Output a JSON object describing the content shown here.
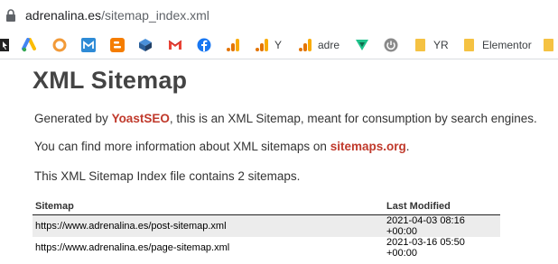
{
  "browser": {
    "url_host": "adrenalina.es",
    "url_path": "/sitemap_index.xml",
    "bookmarks": [
      {
        "icon": "cursor-icon",
        "label": ""
      },
      {
        "icon": "google-ads-icon",
        "label": ""
      },
      {
        "icon": "orange-ring-icon",
        "label": ""
      },
      {
        "icon": "mailchimp-icon",
        "label": ""
      },
      {
        "icon": "blogger-icon",
        "label": ""
      },
      {
        "icon": "cube-icon",
        "label": ""
      },
      {
        "icon": "gmail-icon",
        "label": ""
      },
      {
        "icon": "facebook-icon",
        "label": ""
      },
      {
        "icon": "analytics-icon",
        "label": ""
      },
      {
        "icon": "analytics-icon",
        "label": "Y"
      },
      {
        "icon": "analytics-icon",
        "label": "adre"
      },
      {
        "icon": "vee-icon",
        "label": ""
      },
      {
        "icon": "power-icon",
        "label": ""
      },
      {
        "icon": "folder-icon",
        "label": "YR"
      },
      {
        "icon": "folder-icon",
        "label": "Elementor"
      },
      {
        "icon": "folder-icon",
        "label": ""
      }
    ]
  },
  "page": {
    "title": "XML Sitemap",
    "intro_prefix": "Generated by ",
    "intro_link": "YoastSEO",
    "intro_suffix": ", this is an XML Sitemap, meant for consumption by search engines.",
    "info_prefix": "You can find more information about XML sitemaps on ",
    "info_link": "sitemaps.org",
    "info_suffix": ".",
    "summary": "This XML Sitemap Index file contains 2 sitemaps.",
    "table": {
      "headers": [
        "Sitemap",
        "Last Modified"
      ],
      "rows": [
        {
          "url": "https://www.adrenalina.es/post-sitemap.xml",
          "modified": "2021-04-03 08:16 +00:00"
        },
        {
          "url": "https://www.adrenalina.es/page-sitemap.xml",
          "modified": "2021-03-16 05:50 +00:00"
        }
      ]
    }
  },
  "colors": {
    "link": "#c0392b",
    "title": "#444444",
    "row_stripe": "#ececec"
  }
}
